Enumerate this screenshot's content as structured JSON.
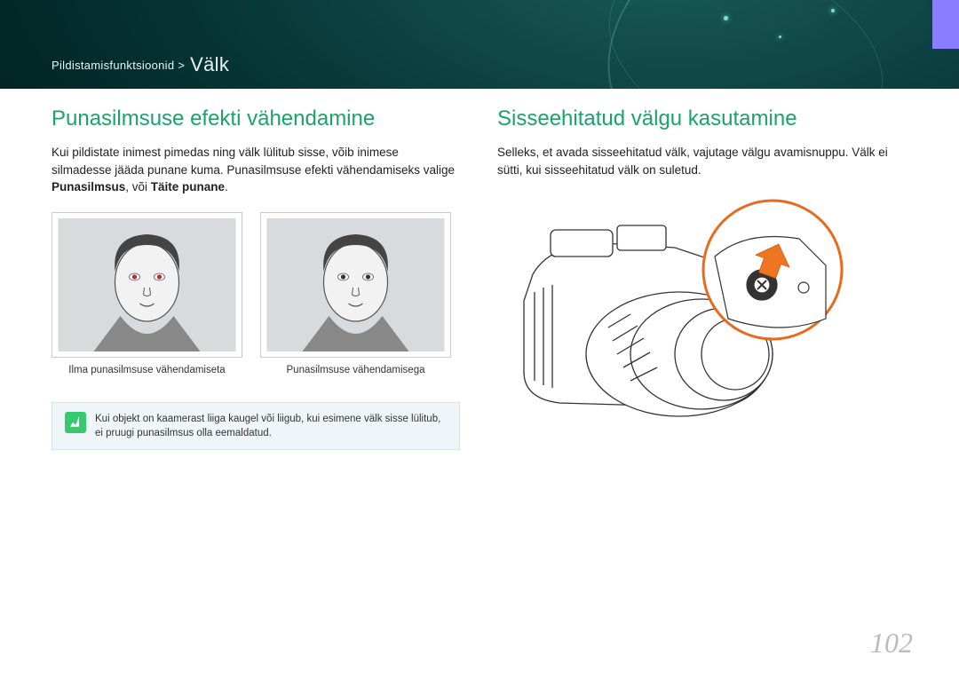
{
  "breadcrumb": {
    "prefix": "Pildistamisfunktsioonid >",
    "current": "Välk"
  },
  "left": {
    "heading": "Punasilmsuse efekti vähendamine",
    "para_a": "Kui pildistate inimest pimedas ning välk lülitub sisse, võib inimese silmadesse jääda punane kuma. Punasilmsuse efekti vähendamiseks valige ",
    "para_b1": "Punasilmsus",
    "para_mid": ", või ",
    "para_b2": "Täite punane",
    "para_end": ".",
    "caption1": "Ilma punasilmsuse vähendamiseta",
    "caption2": "Punasilmsuse vähendamisega",
    "note": "Kui objekt on kaamerast liiga kaugel või liigub, kui esimene välk sisse lülitub, ei pruugi punasilmsus olla eemaldatud."
  },
  "right": {
    "heading": "Sisseehitatud välgu kasutamine",
    "para": "Selleks, et avada sisseehitatud välk, vajutage välgu avamisnuppu. Välk ei sütti, kui sisseehitatud välk on suletud."
  },
  "page_number": "102"
}
